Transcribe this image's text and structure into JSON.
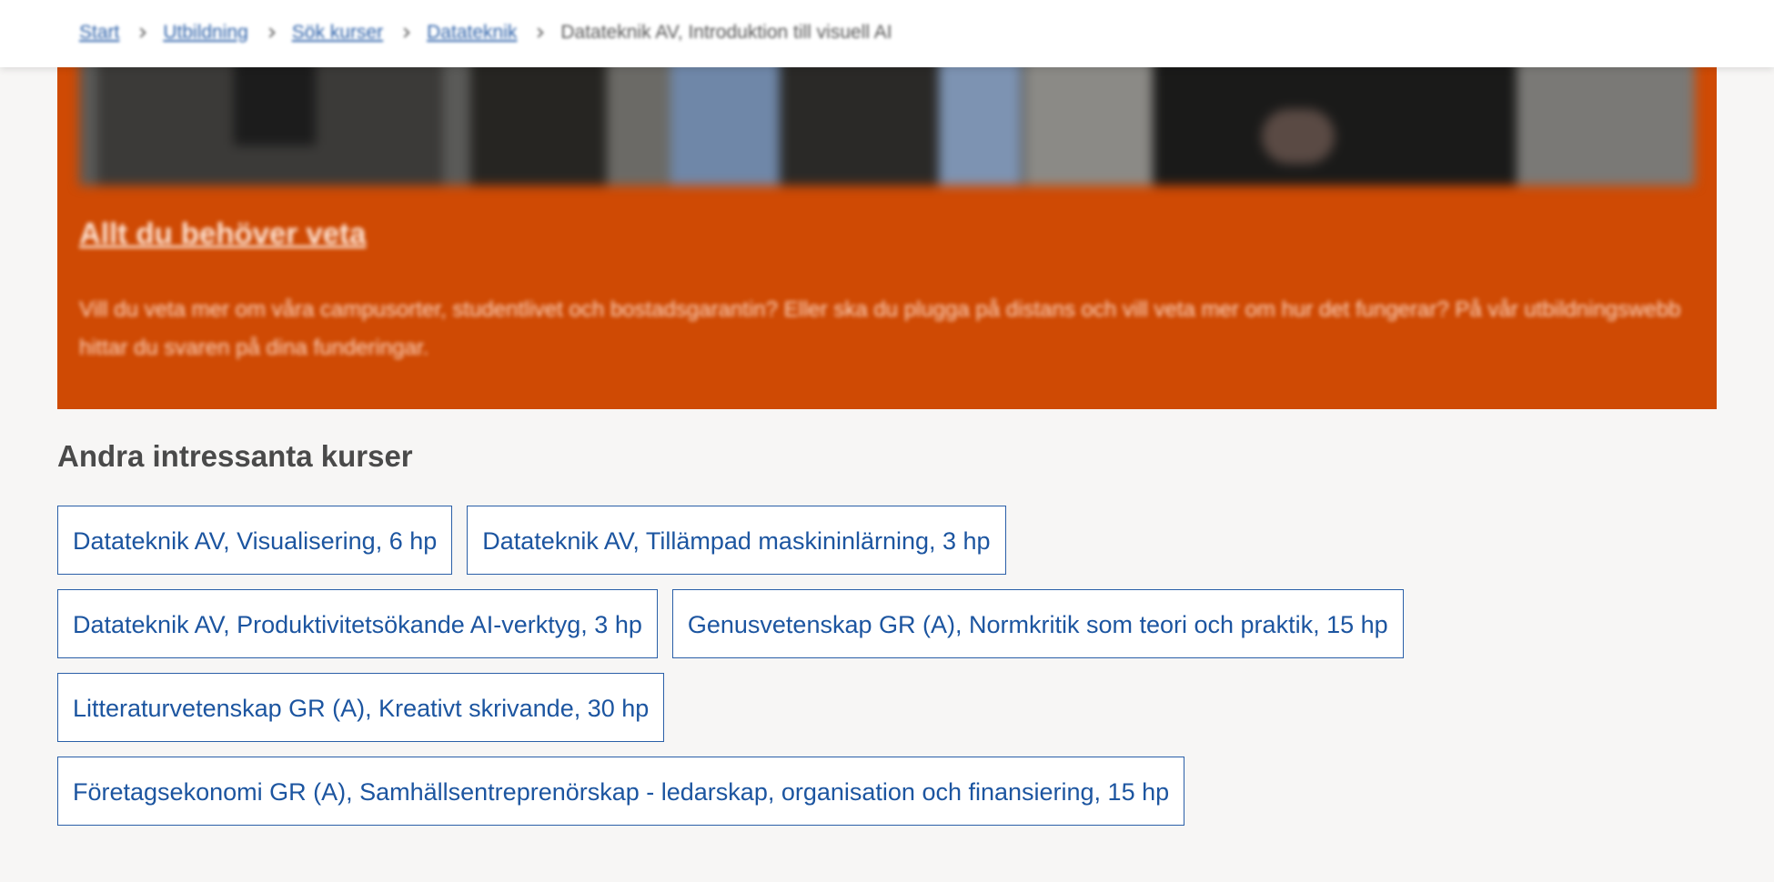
{
  "breadcrumb": {
    "items": [
      "Start",
      "Utbildning",
      "Sök kurser",
      "Datateknik"
    ],
    "current": "Datateknik AV, Introduktion till visuell AI"
  },
  "promo": {
    "link": "Allt du behöver veta",
    "text": "Vill du veta mer om våra campusorter, studentlivet och bostadsgarantin? Eller ska du plugga på distans och vill veta mer om hur det fungerar? På vår utbildningswebb hittar du svaren på dina funderingar.",
    "background_color": "#cf4a04"
  },
  "related": {
    "title": "Andra intressanta kurser",
    "courses": [
      "Datateknik AV, Visualisering, 6 hp",
      "Datateknik AV, Tillämpad maskininlärning, 3 hp",
      "Datateknik AV, Produktivitetsökande AI-verktyg, 3 hp",
      "Genusvetenskap GR (A), Normkritik som teori och praktik, 15 hp",
      "Litteraturvetenskap GR (A), Kreativt skrivande, 30 hp",
      "Företagsekonomi GR (A), Samhällsentreprenörskap - ledarskap, organisation och finansiering, 15 hp"
    ],
    "link_color": "#1c55a0"
  },
  "icons": {
    "breadcrumb_separator": "chevron-right-icon"
  }
}
